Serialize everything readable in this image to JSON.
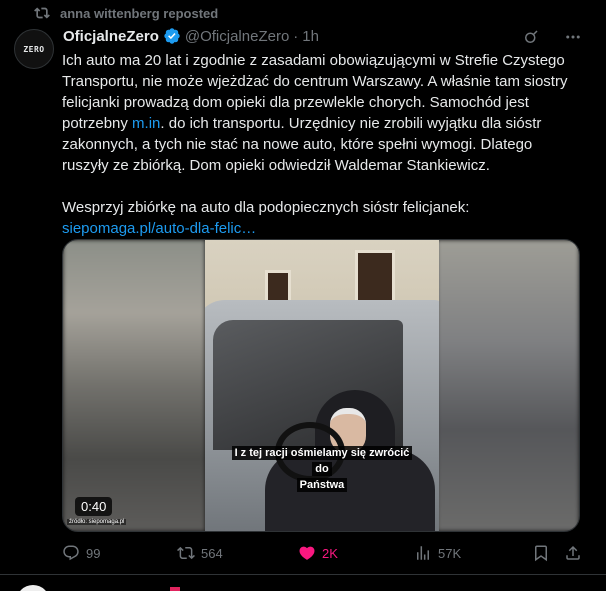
{
  "repost": {
    "text": "anna wittenberg reposted",
    "icon": "repost-icon"
  },
  "author": {
    "avatar_text": "ZERO",
    "display_name": "OficjalneZero",
    "handle": "@OficjalneZero",
    "separator": "·",
    "time": "1h",
    "verified_color": "#1d9bf0"
  },
  "tweet": {
    "paragraph1_part1": "Ich auto ma 20 lat i zgodnie z zasadami obowiązującymi w Strefie Czystego Transportu, nie może wjeżdżać do centrum Warszawy. A właśnie tam siostry felicjanki prowadzą dom opieki dla przewlekle chorych. Samochód jest potrzebny ",
    "paragraph1_link": "m.in",
    "paragraph1_part2": ". do ich transportu. Urzędnicy nie zrobili wyjątku dla sióstr zakonnych, a tych nie stać na nowe auto, które spełni wymogi. Dlatego ruszyły ze zbiórką. Dom opieki odwiedził Waldemar Stankiewicz.",
    "paragraph2": "Wesprzyj zbiórkę na auto dla podopiecznych sióstr felicjanek:",
    "link": "siepomaga.pl/auto-dla-felic…"
  },
  "video": {
    "subtitle_line1": "I z tej racji ośmielamy się zwrócić do",
    "subtitle_line2": "Państwa",
    "duration": "0:40",
    "source": "źródło: siepomaga.pl"
  },
  "actions": {
    "replies": "99",
    "reposts": "564",
    "likes": "2K",
    "views": "57K"
  },
  "colors": {
    "background": "#000000",
    "text": "#e7e9ea",
    "muted": "#71767b",
    "link": "#1d9bf0",
    "like": "#f91880"
  }
}
